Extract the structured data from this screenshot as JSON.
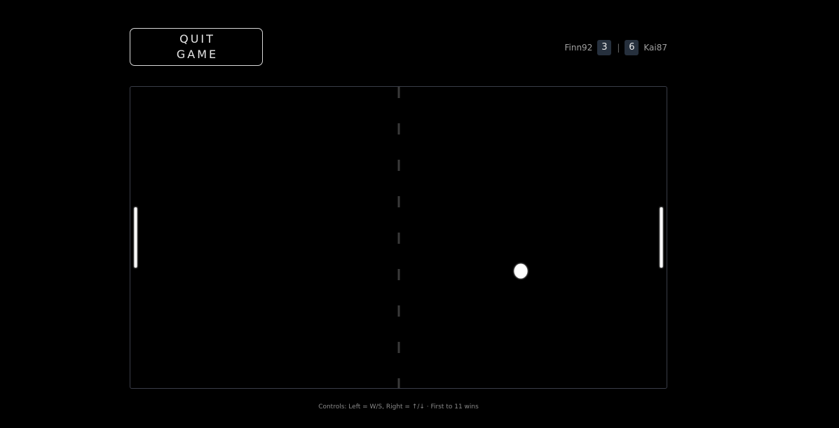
{
  "quit_button": {
    "line1": "QUIT",
    "line2": "GAME"
  },
  "scoreboard": {
    "left_player": "Finn92",
    "left_score": "3",
    "separator": "|",
    "right_score": "6",
    "right_player": "Kai87"
  },
  "footer": {
    "controls_text": "Controls: Left = W/S, Right = ↑/↓ · First to 11 wins"
  },
  "colors": {
    "background": "#000000",
    "paddle": "#ffffff",
    "ball": "#ffffff",
    "center_line": "#3a3a3a",
    "score_box": "#26303d"
  }
}
